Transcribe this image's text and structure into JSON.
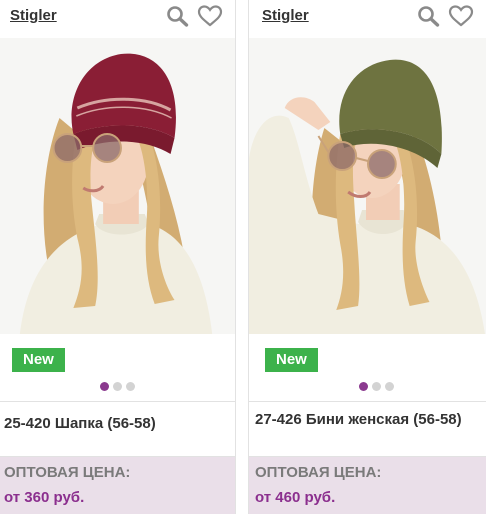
{
  "products": [
    {
      "brand": "Stigler",
      "badge": "New",
      "title": "25-420 Шапка (56-58)",
      "price_label": "ОПТОВАЯ ЦЕНА:",
      "price": "от 360 руб.",
      "image_count": 3,
      "active_image": 1
    },
    {
      "brand": "Stigler",
      "badge": "New",
      "title": "27-426 Бини женская (56-58)",
      "price_label": "ОПТОВАЯ ЦЕНА:",
      "price": "от 460 руб.",
      "image_count": 3,
      "active_image": 1
    }
  ],
  "icons": {
    "search": "magnifier-icon",
    "favorite": "heart-icon"
  },
  "colors": {
    "brand_text": "#333333",
    "badge_bg": "#3cb24b",
    "dot_active": "#8b3a8f",
    "price_bg": "#eadfe9",
    "price_value": "#8b2f8e",
    "hat_1": "#8a1e35",
    "hat_2": "#6e7340",
    "sweater": "#f1eee1"
  }
}
